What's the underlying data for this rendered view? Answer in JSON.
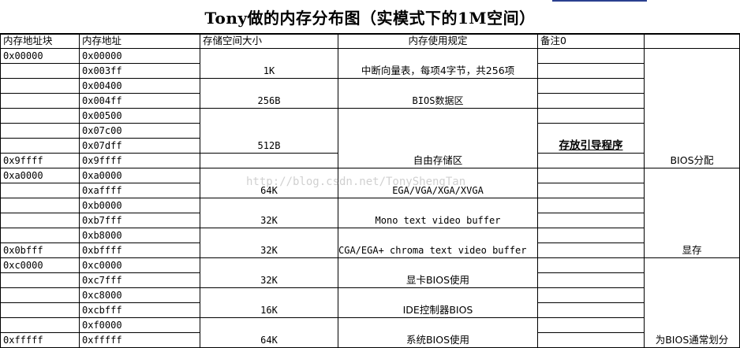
{
  "title": "Tony做的内存分布图（实模式下的1M空间）",
  "headers": [
    "内存地址块",
    "内存地址",
    "存储空间大小",
    "内存使用规定",
    "备注0"
  ],
  "blocks": [
    "0x00000",
    "0x9ffff",
    "0xa0000",
    "0x0bfff",
    "0xc0000",
    "0xfffff"
  ],
  "addresses": [
    "0x00000",
    "0x003ff",
    "0x00400",
    "0x004ff",
    "0x00500",
    "0x07c00",
    "0x07dff",
    "0x9ffff",
    "0xa0000",
    "0xaffff",
    "0xb0000",
    "0xb7fff",
    "0xb8000",
    "0xbffff",
    "0xc0000",
    "0xc7fff",
    "0xc8000",
    "0xcbfff",
    "0xf0000",
    "0xfffff"
  ],
  "sizes": [
    "1K",
    "256B",
    "512B",
    "64K",
    "32K",
    "32K",
    "32K",
    "16K",
    "64K"
  ],
  "usages": [
    "中断向量表，每项4字节，共256项",
    "BIOS数据区",
    "自由存储区",
    "EGA/VGA/XGA/XVGA",
    "Mono text video buffer",
    "CGA/EGA+ chroma text video buffer",
    "显卡BIOS使用",
    "IDE控制器BIOS",
    "系统BIOS使用"
  ],
  "note_boot": "存放引导程序",
  "groups": [
    "BIOS分配",
    "显存",
    "为BIOS通常划分"
  ],
  "watermark": "http://blog.csdn.net/TonyShengTan"
}
